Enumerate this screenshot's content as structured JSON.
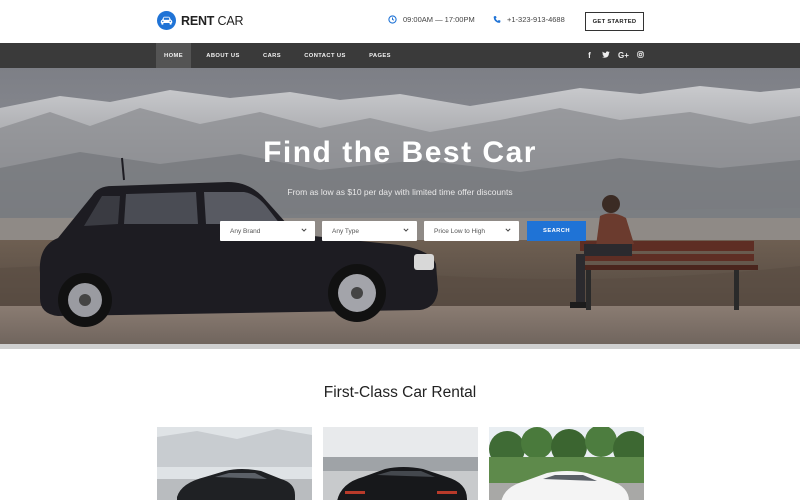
{
  "header": {
    "logo_bold": "RENT",
    "logo_light": " CAR",
    "logo_icon": "car-icon",
    "hours": "09:00AM — 17:00PM",
    "hours_icon": "clock-icon",
    "phone": "+1-323-913-4688",
    "phone_icon": "phone-icon",
    "cta_label": "GET STARTED"
  },
  "nav": {
    "items": [
      {
        "label": "HOME",
        "active": true
      },
      {
        "label": "ABOUT US",
        "active": false
      },
      {
        "label": "CARS",
        "active": false
      },
      {
        "label": "CONTACT US",
        "active": false
      },
      {
        "label": "PAGES",
        "active": false
      }
    ],
    "socials": [
      {
        "glyph": "f",
        "icon": "facebook-icon"
      },
      {
        "glyph": "t",
        "icon": "twitter-icon"
      },
      {
        "glyph": "G+",
        "icon": "google-plus-icon"
      },
      {
        "glyph": "ig",
        "icon": "instagram-icon"
      }
    ]
  },
  "hero": {
    "title": "Find the Best Car",
    "subtitle": "From as low as $10 per day with limited time offer discounts",
    "filters": [
      {
        "value": "Any Brand"
      },
      {
        "value": "Any Type"
      },
      {
        "value": "Price Low to High"
      }
    ],
    "search_label": "SEARCH"
  },
  "section": {
    "title": "First-Class Car Rental",
    "cards": [
      {
        "image": "dark-sedan-photo"
      },
      {
        "image": "black-sports-car-photo"
      },
      {
        "image": "white-sedan-photo"
      }
    ]
  },
  "colors": {
    "accent": "#1f73d6",
    "nav_bg": "#3a3a3a",
    "nav_active": "#545454"
  }
}
